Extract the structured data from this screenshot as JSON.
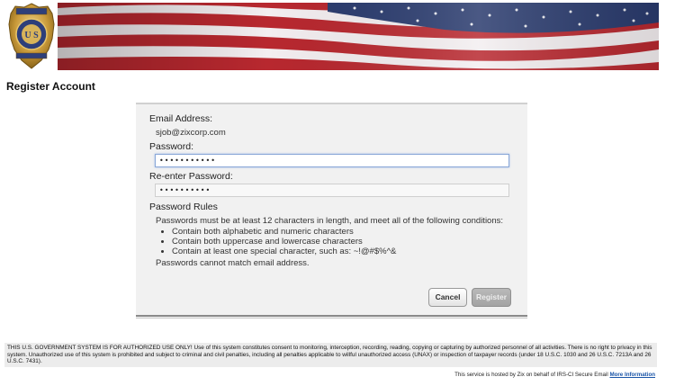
{
  "header": {
    "badge_top_text": "CRIMINAL INVESTIGATION",
    "badge_arc_text": "DEPARTMENT OF THE TREASURY",
    "badge_letters": "U S",
    "badge_bottom_text": "SPECIAL AGENT"
  },
  "page": {
    "title": "Register Account"
  },
  "form": {
    "email_label": "Email Address:",
    "email_value": "sjob@zixcorp.com",
    "password_label": "Password:",
    "password_value": "•••••••••••",
    "reenter_label": "Re-enter Password:",
    "reenter_value": "••••••••••",
    "rules_heading": "Password Rules",
    "rules_intro": "Passwords must be at least 12 characters in length, and meet all of the following conditions:",
    "rules": [
      "Contain both alphabetic and numeric characters",
      "Contain both uppercase and lowercase characters",
      "Contain at least one special character, such as: ~!@#$%^&"
    ],
    "rules_note": "Passwords cannot match email address.",
    "cancel_label": "Cancel",
    "register_label": "Register"
  },
  "footer": {
    "notice": "THIS U.S. GOVERNMENT SYSTEM IS FOR AUTHORIZED USE ONLY! Use of this system constitutes consent to monitoring, interception, recording, reading, copying or capturing by authorized personnel of all activities. There is no right to privacy in this system. Unauthorized use of this system is prohibited and subject to criminal and civil penalties, including all penalties applicable to willful unauthorized access (UNAX) or inspection of taxpayer records (under 18 U.S.C. 1030 and 26 U.S.C. 7213A and 26 U.S.C. 7431).",
    "hosted_text": "This service is hosted by Zix on behalf of IRS-CI Secure Email",
    "more_info_label": "More Information"
  },
  "colors": {
    "flag_red": "#b8282f",
    "flag_blue": "#2a3b6e",
    "badge_gold": "#c99a3a",
    "link": "#1a55a8"
  }
}
